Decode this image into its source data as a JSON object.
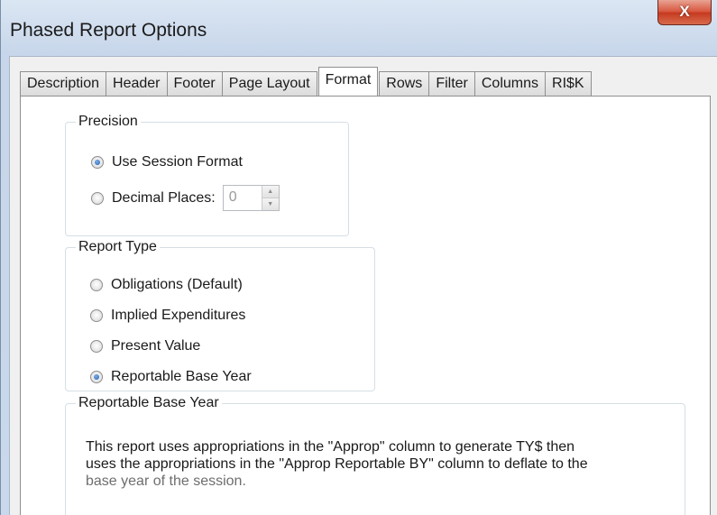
{
  "window": {
    "title": "Phased Report Options",
    "close_glyph": "X"
  },
  "tabs": [
    {
      "label": "Description",
      "active": false
    },
    {
      "label": "Header",
      "active": false
    },
    {
      "label": "Footer",
      "active": false
    },
    {
      "label": "Page Layout",
      "active": false
    },
    {
      "label": "Format",
      "active": true
    },
    {
      "label": "Rows",
      "active": false
    },
    {
      "label": "Filter",
      "active": false
    },
    {
      "label": "Columns",
      "active": false
    },
    {
      "label": "RI$K",
      "active": false
    }
  ],
  "precision": {
    "legend": "Precision",
    "options": [
      {
        "label": "Use Session Format",
        "checked": true
      },
      {
        "label": "Decimal Places:",
        "checked": false
      }
    ],
    "decimal_places_value": "0",
    "spin_up_icon": "up-arrow-icon",
    "spin_down_icon": "down-arrow-icon"
  },
  "report_type": {
    "legend": "Report Type",
    "options": [
      {
        "label": "Obligations (Default)",
        "checked": false
      },
      {
        "label": "Implied Expenditures",
        "checked": false
      },
      {
        "label": "Present Value",
        "checked": false
      },
      {
        "label": "Reportable Base Year",
        "checked": true
      }
    ]
  },
  "reportable_base_year": {
    "legend": "Reportable Base Year",
    "line1": "This report uses appropriations in the \"Approp\" column to generate TY$ then",
    "line2": "uses the appropriations in the \"Approp Reportable BY\" column to deflate to the",
    "line3": "base year of the session."
  },
  "colors": {
    "radio_checked": "#1f5fb0",
    "close_button": "#c53a20",
    "group_border": "#d5dfe5"
  }
}
